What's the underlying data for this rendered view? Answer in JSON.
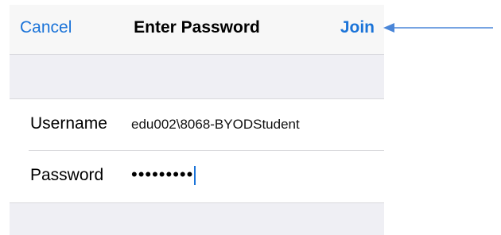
{
  "navbar": {
    "cancel_label": "Cancel",
    "title": "Enter Password",
    "join_label": "Join"
  },
  "form": {
    "username": {
      "label": "Username",
      "value": "edu002\\8068-BYODStudent"
    },
    "password": {
      "label": "Password",
      "masked_value": "•••••••••"
    }
  },
  "annotation": {
    "arrow_color": "#4a86d8",
    "points_to": "Join"
  },
  "colors": {
    "accent": "#1a73d8",
    "background": "#efeff4"
  }
}
